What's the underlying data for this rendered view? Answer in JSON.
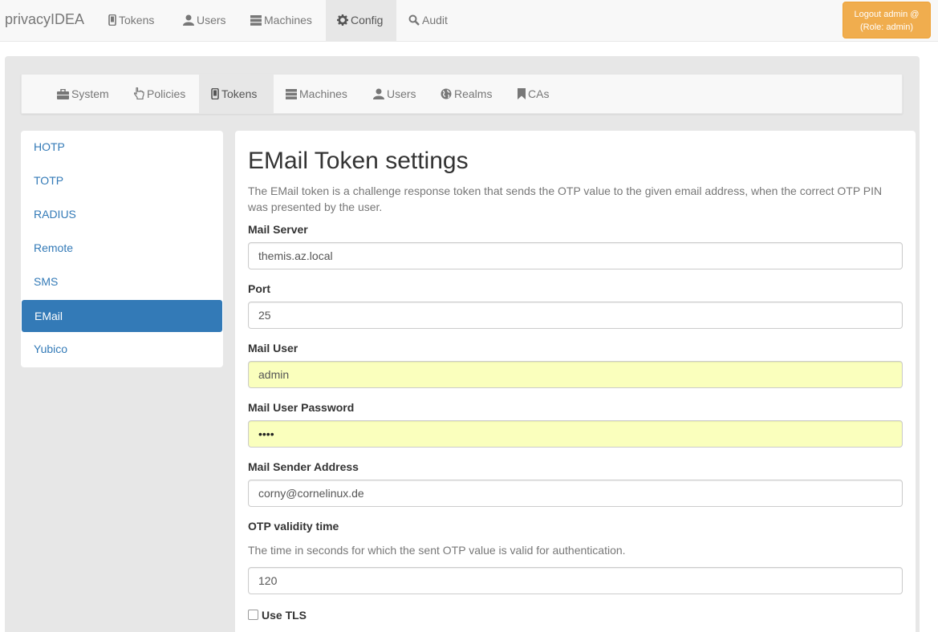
{
  "topnav": {
    "brand": "privacyIDEA",
    "items": [
      {
        "label": "Tokens",
        "icon": "phone-icon"
      },
      {
        "label": "Users",
        "icon": "user-icon"
      },
      {
        "label": "Machines",
        "icon": "server-icon"
      },
      {
        "label": "Config",
        "icon": "gear-icon",
        "active": true
      },
      {
        "label": "Audit",
        "icon": "search-icon"
      }
    ],
    "logout_line1": "Logout admin @",
    "logout_line2": "(Role: admin)"
  },
  "subnav": {
    "items": [
      {
        "label": "System",
        "icon": "briefcase-icon"
      },
      {
        "label": "Policies",
        "icon": "hand-pointer-icon"
      },
      {
        "label": "Tokens",
        "icon": "phone-icon",
        "active": true
      },
      {
        "label": "Machines",
        "icon": "server-icon"
      },
      {
        "label": "Users",
        "icon": "user-icon"
      },
      {
        "label": "Realms",
        "icon": "globe-icon"
      },
      {
        "label": "CAs",
        "icon": "bookmark-icon"
      }
    ]
  },
  "sidelist": {
    "items": [
      "HOTP",
      "TOTP",
      "RADIUS",
      "Remote",
      "SMS",
      "EMail",
      "Yubico"
    ],
    "active": "EMail"
  },
  "content": {
    "title": "EMail Token settings",
    "description": "The EMail token is a challenge response token that sends the OTP value to the given email address, when the correct OTP PIN was presented by the user.",
    "fields": {
      "mail_server": {
        "label": "Mail Server",
        "value": "themis.az.local"
      },
      "port": {
        "label": "Port",
        "value": "25"
      },
      "mail_user": {
        "label": "Mail User",
        "value": "admin"
      },
      "mail_password": {
        "label": "Mail User Password",
        "value": "••••"
      },
      "sender": {
        "label": "Mail Sender Address",
        "value": "corny@cornelinux.de"
      },
      "validity": {
        "label": "OTP validity time",
        "help": "The time in seconds for which the sent OTP value is valid for authentication.",
        "value": "120"
      }
    },
    "use_tls": {
      "label": "Use TLS",
      "checked": false
    }
  },
  "colors": {
    "primary": "#337ab7",
    "warning": "#f0ad4e",
    "autofill": "#faffbd"
  }
}
